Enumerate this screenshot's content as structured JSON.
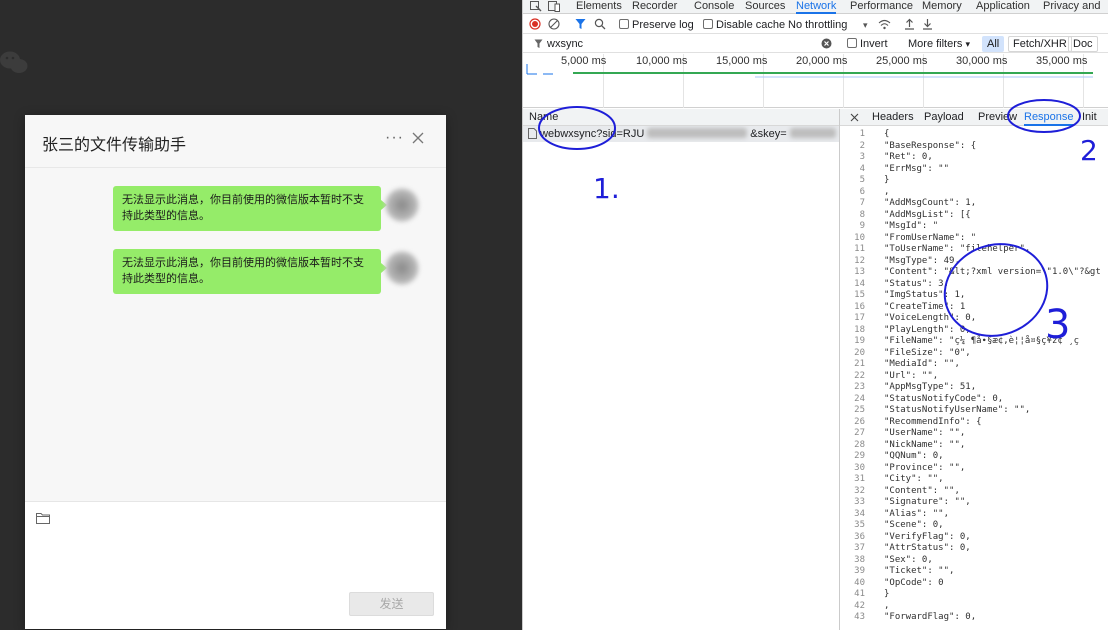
{
  "wechat": {
    "title": "张三的文件传输助手",
    "more_glyph": "···",
    "messages": [
      {
        "text": "无法显示此消息，你目前使用的微信版本暂时不支持此类型的信息。"
      },
      {
        "text": "无法显示此消息，你目前使用的微信版本暂时不支持此类型的信息。"
      }
    ],
    "send_label": "发送",
    "bubble_color": "#95ec69"
  },
  "devtools": {
    "tabs": [
      "Elements",
      "Recorder",
      "Console",
      "Sources",
      "Network",
      "Performance",
      "Memory",
      "Application",
      "Privacy and"
    ],
    "active_tab": "Network",
    "accent": "#1a73e8",
    "toolbar": {
      "preserve_log": "Preserve log",
      "disable_cache": "Disable cache",
      "throttling": "No throttling"
    },
    "filter": {
      "value": "wxsync",
      "invert": "Invert",
      "more_filters": "More filters",
      "types": [
        "All",
        "Fetch/XHR",
        "Doc"
      ],
      "selected_type": "All"
    },
    "timeline_ticks": [
      "5,000 ms",
      "10,000 ms",
      "15,000 ms",
      "20,000 ms",
      "25,000 ms",
      "30,000 ms",
      "35,000 ms"
    ],
    "name_header": "Name",
    "request": {
      "prefix": "webwxsync?sid=RJU",
      "mid": "&skey="
    },
    "detail_tabs": [
      "Headers",
      "Payload",
      "Preview",
      "Response",
      "Init"
    ],
    "detail_active": "Response",
    "response_lines": [
      "{",
      "\"BaseResponse\": {",
      "\"Ret\": 0,",
      "\"ErrMsg\": \"\"",
      "}",
      ",",
      "\"AddMsgCount\": 1,",
      "\"AddMsgList\": [{",
      "\"MsgId\": \"",
      "\"FromUserName\": \"",
      "\"ToUserName\": \"filehelper\",",
      "\"MsgType\": 49,",
      "\"Content\": \"&lt;?xml version=\\\"1.0\\\"?&gt",
      "\"Status\": 3,",
      "\"ImgStatus\": 1,",
      "\"CreateTime\": 1",
      "\"VoiceLength\": 0,",
      "\"PlayLength\": 0,",
      "\"FileName\": \"ç¼ ¶å∙§æ¢,è¦¦å¤§ç¥ž¢ ¸ç",
      "\"FileSize\": \"0\",",
      "\"MediaId\": \"\",",
      "\"Url\": \"\",",
      "\"AppMsgType\": 51,",
      "\"StatusNotifyCode\": 0,",
      "\"StatusNotifyUserName\": \"\",",
      "\"RecommendInfo\": {",
      "\"UserName\": \"\",",
      "\"NickName\": \"\",",
      "\"QQNum\": 0,",
      "\"Province\": \"\",",
      "\"City\": \"\",",
      "\"Content\": \"\",",
      "\"Signature\": \"\",",
      "\"Alias\": \"\",",
      "\"Scene\": 0,",
      "\"VerifyFlag\": 0,",
      "\"AttrStatus\": 0,",
      "\"Sex\": 0,",
      "\"Ticket\": \"\",",
      "\"OpCode\": 0",
      "}",
      ",",
      "\"ForwardFlag\": 0,"
    ]
  },
  "annotations": {
    "labels": [
      "1.",
      "2",
      "3"
    ],
    "color": "#1e1ed8"
  }
}
